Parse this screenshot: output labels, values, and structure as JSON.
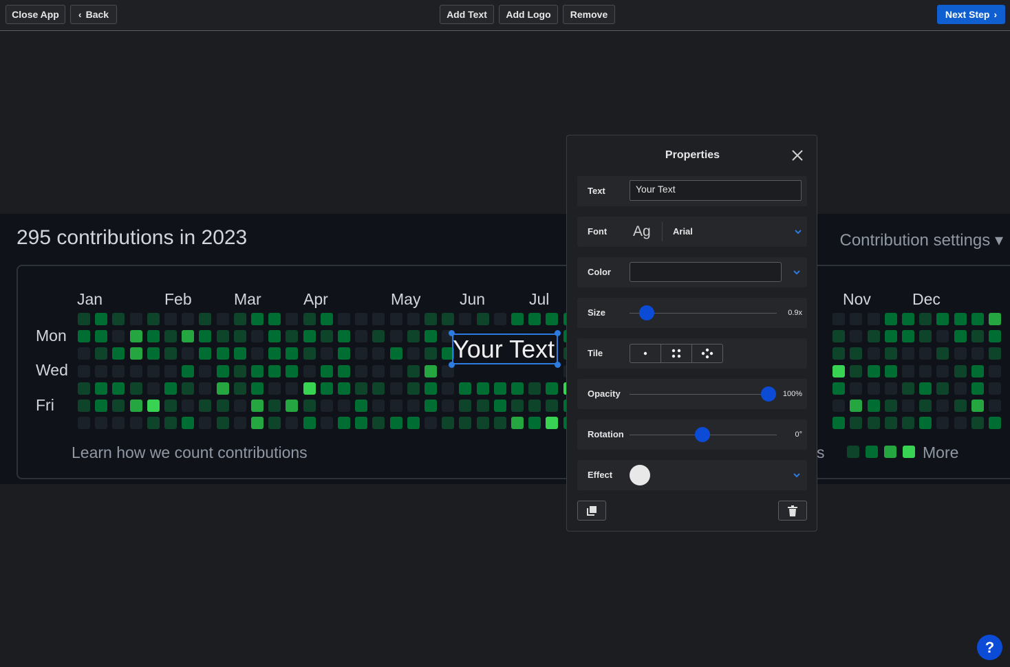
{
  "toolbar": {
    "close_label": "Close App",
    "back_label": "Back",
    "add_text_label": "Add Text",
    "add_logo_label": "Add Logo",
    "remove_label": "Remove",
    "next_label": "Next Step"
  },
  "canvas": {
    "title": "295 contributions in 2023",
    "settings_label": "Contribution settings",
    "months": [
      "Jan",
      "Feb",
      "Mar",
      "Apr",
      "May",
      "Jun",
      "Jul",
      "Nov",
      "Dec"
    ],
    "days": [
      "Mon",
      "Wed",
      "Fri"
    ],
    "learn_link": "Learn how we count contributions",
    "legend_fragment": "s",
    "legend_more": "More",
    "overlay_text": "Your Text",
    "colors": {
      "empty": "#1a2128",
      "level1": "#0e4429",
      "level2": "#006d32",
      "level3": "#26a641",
      "level4": "#39d353"
    }
  },
  "properties": {
    "title": "Properties",
    "text_label": "Text",
    "text_value": "Your Text",
    "font_label": "Font",
    "font_preview": "Ag",
    "font_value": "Arial",
    "color_label": "Color",
    "color_value": "",
    "size_label": "Size",
    "size_value": "0.9x",
    "tile_label": "Tile",
    "tile_options": [
      "single-dot-icon",
      "four-dots-icon",
      "scatter-dots-icon"
    ],
    "opacity_label": "Opacity",
    "opacity_value": "100%",
    "opacity_fraction": 1.0,
    "rotation_label": "Rotation",
    "rotation_value": "0°",
    "effect_label": "Effect"
  },
  "help_label": "?"
}
